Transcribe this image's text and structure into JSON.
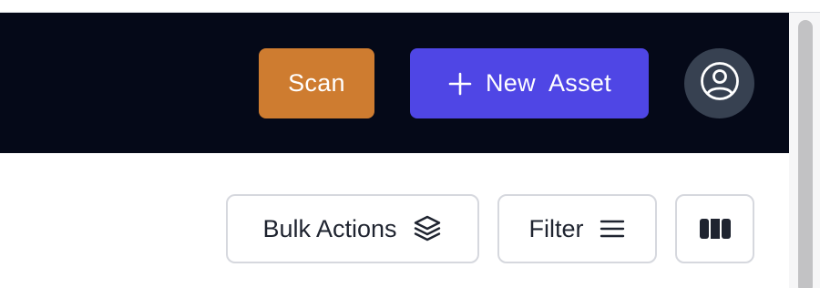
{
  "header": {
    "scan_label": "Scan",
    "new_asset_label": "New  Asset",
    "icons": {
      "plus": "plus-icon",
      "user": "user-circle-icon"
    }
  },
  "toolbar": {
    "bulk_actions_label": "Bulk Actions",
    "filter_label": "Filter",
    "icons": {
      "bulk": "layers-icon",
      "filter": "menu-lines-icon",
      "columns": "columns-icon"
    }
  },
  "colors": {
    "header_bg": "#050918",
    "scan_button": "#ce7c30",
    "primary_button": "#4f46e5",
    "avatar_bg": "#374151"
  }
}
